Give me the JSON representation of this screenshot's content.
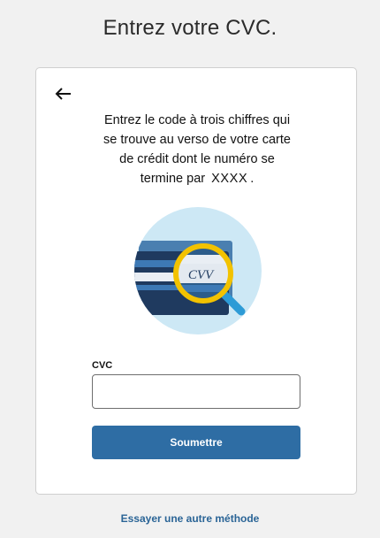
{
  "page": {
    "title": "Entrez votre CVC."
  },
  "card": {
    "back_icon": "arrow-left-icon",
    "instruction_lines": [
      "Entrez le code à trois chiffres qui",
      "se trouve au verso de votre carte",
      "de crédit dont le numéro se"
    ],
    "instruction_last_prefix": "termine par",
    "card_number_mask": "XXXX",
    "instruction_last_suffix": ".",
    "illustration": {
      "icon": "credit-card-cvv-magnifier-icon",
      "cvv_text": "CVV"
    },
    "cvc_field": {
      "label": "CVC",
      "value": "",
      "placeholder": ""
    },
    "submit_label": "Soumettre"
  },
  "alternate_method_link": "Essayer une autre méthode",
  "colors": {
    "background": "#f1f1f1",
    "primary_button": "#2e6da4",
    "link": "#2a6496",
    "illustration_circle": "#cde8f5",
    "card_navy": "#1f3a5f",
    "magnifier_ring": "#f2c200"
  }
}
